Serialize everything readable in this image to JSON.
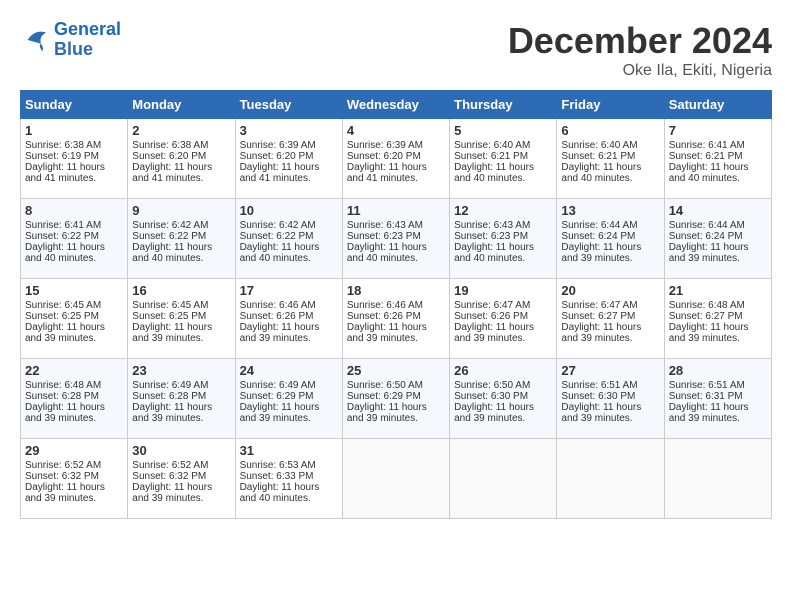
{
  "header": {
    "logo_line1": "General",
    "logo_line2": "Blue",
    "month": "December 2024",
    "location": "Oke Ila, Ekiti, Nigeria"
  },
  "weekdays": [
    "Sunday",
    "Monday",
    "Tuesday",
    "Wednesday",
    "Thursday",
    "Friday",
    "Saturday"
  ],
  "weeks": [
    [
      {
        "day": "1",
        "info": "Sunrise: 6:38 AM\nSunset: 6:19 PM\nDaylight: 11 hours and 41 minutes."
      },
      {
        "day": "2",
        "info": "Sunrise: 6:38 AM\nSunset: 6:20 PM\nDaylight: 11 hours and 41 minutes."
      },
      {
        "day": "3",
        "info": "Sunrise: 6:39 AM\nSunset: 6:20 PM\nDaylight: 11 hours and 41 minutes."
      },
      {
        "day": "4",
        "info": "Sunrise: 6:39 AM\nSunset: 6:20 PM\nDaylight: 11 hours and 41 minutes."
      },
      {
        "day": "5",
        "info": "Sunrise: 6:40 AM\nSunset: 6:21 PM\nDaylight: 11 hours and 40 minutes."
      },
      {
        "day": "6",
        "info": "Sunrise: 6:40 AM\nSunset: 6:21 PM\nDaylight: 11 hours and 40 minutes."
      },
      {
        "day": "7",
        "info": "Sunrise: 6:41 AM\nSunset: 6:21 PM\nDaylight: 11 hours and 40 minutes."
      }
    ],
    [
      {
        "day": "8",
        "info": "Sunrise: 6:41 AM\nSunset: 6:22 PM\nDaylight: 11 hours and 40 minutes."
      },
      {
        "day": "9",
        "info": "Sunrise: 6:42 AM\nSunset: 6:22 PM\nDaylight: 11 hours and 40 minutes."
      },
      {
        "day": "10",
        "info": "Sunrise: 6:42 AM\nSunset: 6:22 PM\nDaylight: 11 hours and 40 minutes."
      },
      {
        "day": "11",
        "info": "Sunrise: 6:43 AM\nSunset: 6:23 PM\nDaylight: 11 hours and 40 minutes."
      },
      {
        "day": "12",
        "info": "Sunrise: 6:43 AM\nSunset: 6:23 PM\nDaylight: 11 hours and 40 minutes."
      },
      {
        "day": "13",
        "info": "Sunrise: 6:44 AM\nSunset: 6:24 PM\nDaylight: 11 hours and 39 minutes."
      },
      {
        "day": "14",
        "info": "Sunrise: 6:44 AM\nSunset: 6:24 PM\nDaylight: 11 hours and 39 minutes."
      }
    ],
    [
      {
        "day": "15",
        "info": "Sunrise: 6:45 AM\nSunset: 6:25 PM\nDaylight: 11 hours and 39 minutes."
      },
      {
        "day": "16",
        "info": "Sunrise: 6:45 AM\nSunset: 6:25 PM\nDaylight: 11 hours and 39 minutes."
      },
      {
        "day": "17",
        "info": "Sunrise: 6:46 AM\nSunset: 6:26 PM\nDaylight: 11 hours and 39 minutes."
      },
      {
        "day": "18",
        "info": "Sunrise: 6:46 AM\nSunset: 6:26 PM\nDaylight: 11 hours and 39 minutes."
      },
      {
        "day": "19",
        "info": "Sunrise: 6:47 AM\nSunset: 6:26 PM\nDaylight: 11 hours and 39 minutes."
      },
      {
        "day": "20",
        "info": "Sunrise: 6:47 AM\nSunset: 6:27 PM\nDaylight: 11 hours and 39 minutes."
      },
      {
        "day": "21",
        "info": "Sunrise: 6:48 AM\nSunset: 6:27 PM\nDaylight: 11 hours and 39 minutes."
      }
    ],
    [
      {
        "day": "22",
        "info": "Sunrise: 6:48 AM\nSunset: 6:28 PM\nDaylight: 11 hours and 39 minutes."
      },
      {
        "day": "23",
        "info": "Sunrise: 6:49 AM\nSunset: 6:28 PM\nDaylight: 11 hours and 39 minutes."
      },
      {
        "day": "24",
        "info": "Sunrise: 6:49 AM\nSunset: 6:29 PM\nDaylight: 11 hours and 39 minutes."
      },
      {
        "day": "25",
        "info": "Sunrise: 6:50 AM\nSunset: 6:29 PM\nDaylight: 11 hours and 39 minutes."
      },
      {
        "day": "26",
        "info": "Sunrise: 6:50 AM\nSunset: 6:30 PM\nDaylight: 11 hours and 39 minutes."
      },
      {
        "day": "27",
        "info": "Sunrise: 6:51 AM\nSunset: 6:30 PM\nDaylight: 11 hours and 39 minutes."
      },
      {
        "day": "28",
        "info": "Sunrise: 6:51 AM\nSunset: 6:31 PM\nDaylight: 11 hours and 39 minutes."
      }
    ],
    [
      {
        "day": "29",
        "info": "Sunrise: 6:52 AM\nSunset: 6:32 PM\nDaylight: 11 hours and 39 minutes."
      },
      {
        "day": "30",
        "info": "Sunrise: 6:52 AM\nSunset: 6:32 PM\nDaylight: 11 hours and 39 minutes."
      },
      {
        "day": "31",
        "info": "Sunrise: 6:53 AM\nSunset: 6:33 PM\nDaylight: 11 hours and 40 minutes."
      },
      null,
      null,
      null,
      null
    ]
  ]
}
